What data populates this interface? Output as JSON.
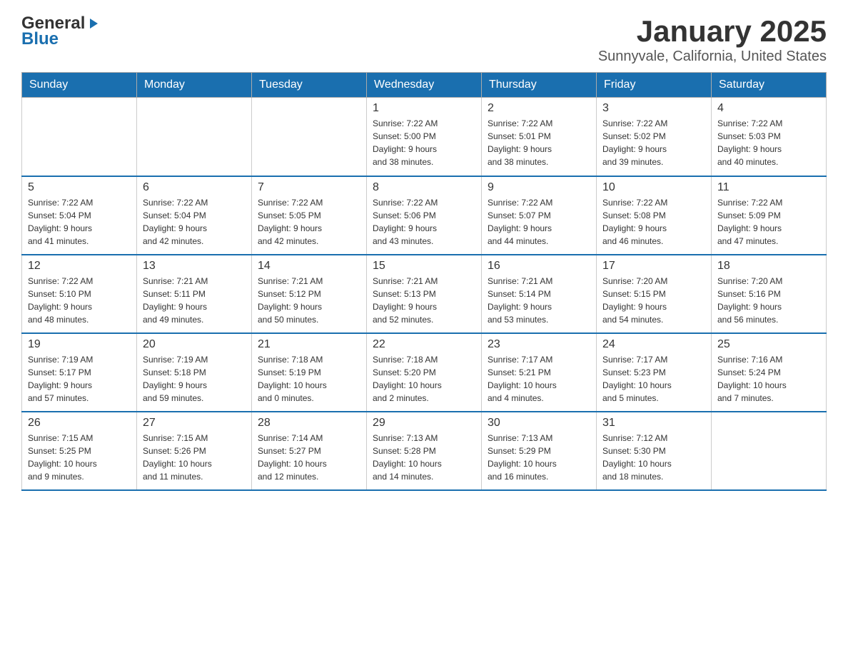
{
  "header": {
    "logo_general": "General",
    "logo_blue": "Blue",
    "title": "January 2025",
    "subtitle": "Sunnyvale, California, United States"
  },
  "calendar": {
    "days_of_week": [
      "Sunday",
      "Monday",
      "Tuesday",
      "Wednesday",
      "Thursday",
      "Friday",
      "Saturday"
    ],
    "weeks": [
      [
        {
          "day": "",
          "info": ""
        },
        {
          "day": "",
          "info": ""
        },
        {
          "day": "",
          "info": ""
        },
        {
          "day": "1",
          "info": "Sunrise: 7:22 AM\nSunset: 5:00 PM\nDaylight: 9 hours\nand 38 minutes."
        },
        {
          "day": "2",
          "info": "Sunrise: 7:22 AM\nSunset: 5:01 PM\nDaylight: 9 hours\nand 38 minutes."
        },
        {
          "day": "3",
          "info": "Sunrise: 7:22 AM\nSunset: 5:02 PM\nDaylight: 9 hours\nand 39 minutes."
        },
        {
          "day": "4",
          "info": "Sunrise: 7:22 AM\nSunset: 5:03 PM\nDaylight: 9 hours\nand 40 minutes."
        }
      ],
      [
        {
          "day": "5",
          "info": "Sunrise: 7:22 AM\nSunset: 5:04 PM\nDaylight: 9 hours\nand 41 minutes."
        },
        {
          "day": "6",
          "info": "Sunrise: 7:22 AM\nSunset: 5:04 PM\nDaylight: 9 hours\nand 42 minutes."
        },
        {
          "day": "7",
          "info": "Sunrise: 7:22 AM\nSunset: 5:05 PM\nDaylight: 9 hours\nand 42 minutes."
        },
        {
          "day": "8",
          "info": "Sunrise: 7:22 AM\nSunset: 5:06 PM\nDaylight: 9 hours\nand 43 minutes."
        },
        {
          "day": "9",
          "info": "Sunrise: 7:22 AM\nSunset: 5:07 PM\nDaylight: 9 hours\nand 44 minutes."
        },
        {
          "day": "10",
          "info": "Sunrise: 7:22 AM\nSunset: 5:08 PM\nDaylight: 9 hours\nand 46 minutes."
        },
        {
          "day": "11",
          "info": "Sunrise: 7:22 AM\nSunset: 5:09 PM\nDaylight: 9 hours\nand 47 minutes."
        }
      ],
      [
        {
          "day": "12",
          "info": "Sunrise: 7:22 AM\nSunset: 5:10 PM\nDaylight: 9 hours\nand 48 minutes."
        },
        {
          "day": "13",
          "info": "Sunrise: 7:21 AM\nSunset: 5:11 PM\nDaylight: 9 hours\nand 49 minutes."
        },
        {
          "day": "14",
          "info": "Sunrise: 7:21 AM\nSunset: 5:12 PM\nDaylight: 9 hours\nand 50 minutes."
        },
        {
          "day": "15",
          "info": "Sunrise: 7:21 AM\nSunset: 5:13 PM\nDaylight: 9 hours\nand 52 minutes."
        },
        {
          "day": "16",
          "info": "Sunrise: 7:21 AM\nSunset: 5:14 PM\nDaylight: 9 hours\nand 53 minutes."
        },
        {
          "day": "17",
          "info": "Sunrise: 7:20 AM\nSunset: 5:15 PM\nDaylight: 9 hours\nand 54 minutes."
        },
        {
          "day": "18",
          "info": "Sunrise: 7:20 AM\nSunset: 5:16 PM\nDaylight: 9 hours\nand 56 minutes."
        }
      ],
      [
        {
          "day": "19",
          "info": "Sunrise: 7:19 AM\nSunset: 5:17 PM\nDaylight: 9 hours\nand 57 minutes."
        },
        {
          "day": "20",
          "info": "Sunrise: 7:19 AM\nSunset: 5:18 PM\nDaylight: 9 hours\nand 59 minutes."
        },
        {
          "day": "21",
          "info": "Sunrise: 7:18 AM\nSunset: 5:19 PM\nDaylight: 10 hours\nand 0 minutes."
        },
        {
          "day": "22",
          "info": "Sunrise: 7:18 AM\nSunset: 5:20 PM\nDaylight: 10 hours\nand 2 minutes."
        },
        {
          "day": "23",
          "info": "Sunrise: 7:17 AM\nSunset: 5:21 PM\nDaylight: 10 hours\nand 4 minutes."
        },
        {
          "day": "24",
          "info": "Sunrise: 7:17 AM\nSunset: 5:23 PM\nDaylight: 10 hours\nand 5 minutes."
        },
        {
          "day": "25",
          "info": "Sunrise: 7:16 AM\nSunset: 5:24 PM\nDaylight: 10 hours\nand 7 minutes."
        }
      ],
      [
        {
          "day": "26",
          "info": "Sunrise: 7:15 AM\nSunset: 5:25 PM\nDaylight: 10 hours\nand 9 minutes."
        },
        {
          "day": "27",
          "info": "Sunrise: 7:15 AM\nSunset: 5:26 PM\nDaylight: 10 hours\nand 11 minutes."
        },
        {
          "day": "28",
          "info": "Sunrise: 7:14 AM\nSunset: 5:27 PM\nDaylight: 10 hours\nand 12 minutes."
        },
        {
          "day": "29",
          "info": "Sunrise: 7:13 AM\nSunset: 5:28 PM\nDaylight: 10 hours\nand 14 minutes."
        },
        {
          "day": "30",
          "info": "Sunrise: 7:13 AM\nSunset: 5:29 PM\nDaylight: 10 hours\nand 16 minutes."
        },
        {
          "day": "31",
          "info": "Sunrise: 7:12 AM\nSunset: 5:30 PM\nDaylight: 10 hours\nand 18 minutes."
        },
        {
          "day": "",
          "info": ""
        }
      ]
    ]
  }
}
